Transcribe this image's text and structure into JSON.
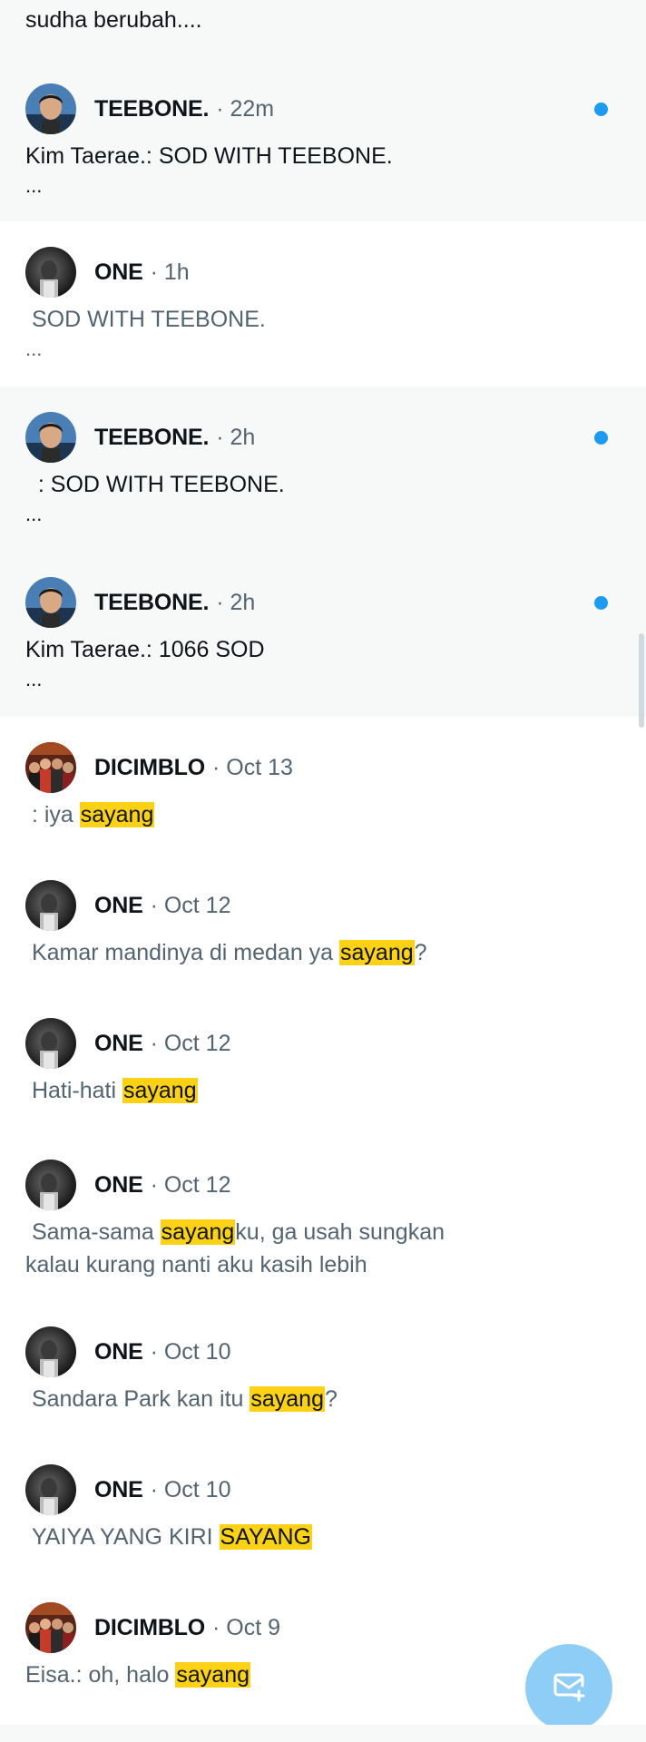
{
  "top_snippet": "sudha berubah....",
  "highlight_word": "sayang",
  "colors": {
    "accent": "#1d9bf0",
    "highlight": "#fcd116",
    "unread_bg": "#f7f9f9"
  },
  "fab": {
    "icon": "new-message-icon"
  },
  "notifications": [
    {
      "name": "TEEBONE.",
      "time": "· 22m",
      "unread": true,
      "avatar": "teebone",
      "msg": [
        {
          "t": "Kim Taerae.: SOD WITH TEEBONE."
        }
      ],
      "ellipsis": "..."
    },
    {
      "name": "ONE",
      "time": "· 1h",
      "unread": false,
      "avatar": "one",
      "msg": [
        {
          "t": " SOD WITH TEEBONE."
        }
      ],
      "ellipsis": "..."
    },
    {
      "name": "TEEBONE.",
      "time": "· 2h",
      "unread": true,
      "avatar": "teebone",
      "msg": [
        {
          "t": "  : SOD WITH TEEBONE."
        }
      ],
      "ellipsis": "..."
    },
    {
      "name": "TEEBONE.",
      "time": "· 2h",
      "unread": true,
      "avatar": "teebone",
      "msg": [
        {
          "t": "Kim Taerae.: 1066 SOD"
        }
      ],
      "ellipsis": "..."
    },
    {
      "name": "DICIMBLO",
      "time": "· Oct 13",
      "unread": false,
      "avatar": "dicimblo",
      "msg": [
        {
          "t": " : iya "
        },
        {
          "t": "sayang",
          "h": true
        }
      ]
    },
    {
      "name": "ONE",
      "time": "· Oct 12",
      "unread": false,
      "avatar": "one",
      "msg": [
        {
          "t": " Kamar mandinya di medan ya "
        },
        {
          "t": "sayang",
          "h": true
        },
        {
          "t": "?"
        }
      ]
    },
    {
      "name": "ONE",
      "time": "· Oct 12",
      "unread": false,
      "avatar": "one",
      "msg": [
        {
          "t": " Hati-hati "
        },
        {
          "t": "sayang",
          "h": true
        }
      ]
    },
    {
      "name": "ONE",
      "time": "· Oct 12",
      "unread": false,
      "avatar": "one",
      "msg": [
        {
          "t": " Sama-sama "
        },
        {
          "t": "sayang",
          "h": true
        },
        {
          "t": "ku, ga usah sungkan kalau kurang nanti aku kasih lebih"
        }
      ]
    },
    {
      "name": "ONE",
      "time": "· Oct 10",
      "unread": false,
      "avatar": "one",
      "msg": [
        {
          "t": " Sandara Park kan itu "
        },
        {
          "t": "sayang",
          "h": true
        },
        {
          "t": "?"
        }
      ]
    },
    {
      "name": "ONE",
      "time": "· Oct 10",
      "unread": false,
      "avatar": "one",
      "msg": [
        {
          "t": " YAIYA YANG KIRI "
        },
        {
          "t": "SAYANG",
          "h": true
        }
      ]
    },
    {
      "name": "DICIMBLO",
      "time": "· Oct 9",
      "unread": false,
      "avatar": "dicimblo",
      "msg": [
        {
          "t": "Eisa.: oh, halo "
        },
        {
          "t": "sayang",
          "h": true
        }
      ]
    }
  ]
}
